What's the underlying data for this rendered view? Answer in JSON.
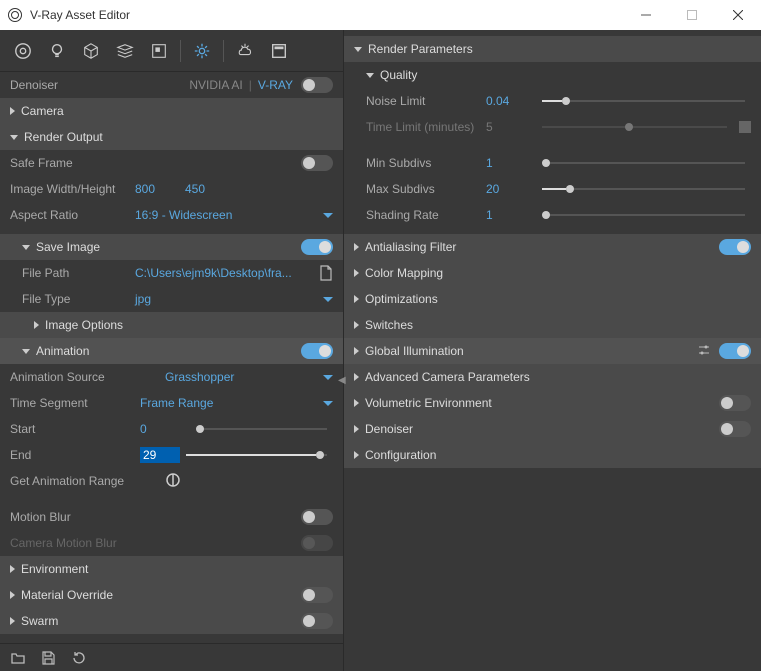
{
  "window": {
    "title": "V-Ray Asset Editor"
  },
  "left": {
    "denoiser": {
      "label": "Denoiser",
      "opt1": "NVIDIA AI",
      "opt2": "V-RAY"
    },
    "camera": {
      "label": "Camera"
    },
    "renderOutput": {
      "label": "Render Output"
    },
    "safeFrame": {
      "label": "Safe Frame"
    },
    "imageWH": {
      "label": "Image Width/Height",
      "w": "800",
      "h": "450"
    },
    "aspect": {
      "label": "Aspect Ratio",
      "value": "16:9 - Widescreen"
    },
    "saveImage": {
      "label": "Save Image"
    },
    "filePath": {
      "label": "File Path",
      "value": "C:\\Users\\ejm9k\\Desktop\\fra..."
    },
    "fileType": {
      "label": "File Type",
      "value": "jpg"
    },
    "imageOptions": {
      "label": "Image Options"
    },
    "animation": {
      "label": "Animation"
    },
    "animSource": {
      "label": "Animation Source",
      "value": "Grasshopper"
    },
    "timeSegment": {
      "label": "Time Segment",
      "value": "Frame Range"
    },
    "start": {
      "label": "Start",
      "value": "0"
    },
    "end": {
      "label": "End",
      "value": "29"
    },
    "getRange": {
      "label": "Get Animation Range"
    },
    "motionBlur": {
      "label": "Motion Blur"
    },
    "camMotionBlur": {
      "label": "Camera Motion Blur"
    },
    "environment": {
      "label": "Environment"
    },
    "matOverride": {
      "label": "Material Override"
    },
    "swarm": {
      "label": "Swarm"
    }
  },
  "right": {
    "renderParams": "Render Parameters",
    "quality": "Quality",
    "noiseLimit": {
      "label": "Noise Limit",
      "value": "0.04"
    },
    "timeLimit": {
      "label": "Time Limit (minutes)",
      "value": "5"
    },
    "minSubdivs": {
      "label": "Min Subdivs",
      "value": "1"
    },
    "maxSubdivs": {
      "label": "Max Subdivs",
      "value": "20"
    },
    "shadingRate": {
      "label": "Shading Rate",
      "value": "1"
    },
    "aa": "Antialiasing Filter",
    "colorMapping": "Color Mapping",
    "optimizations": "Optimizations",
    "switches": "Switches",
    "gi": "Global Illumination",
    "advCam": "Advanced Camera Parameters",
    "volEnv": "Volumetric Environment",
    "denoiser": "Denoiser",
    "config": "Configuration"
  }
}
